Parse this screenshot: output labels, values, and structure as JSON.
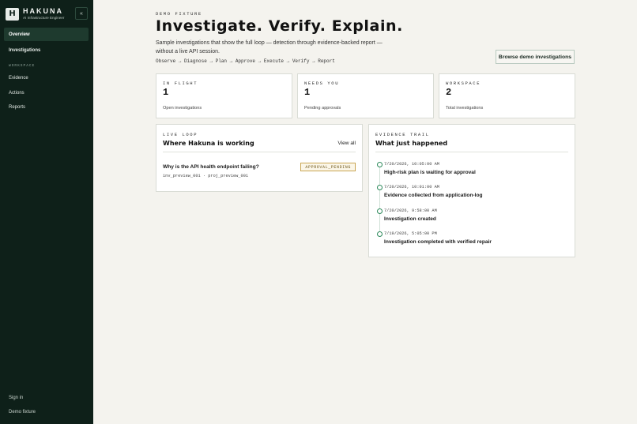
{
  "brand": {
    "logo_letter": "H",
    "name": "HAKUNA",
    "subtitle": "AI Infrastructure Engineer",
    "collapse_icon": "«"
  },
  "sidebar": {
    "items_top": [
      {
        "label": "Overview",
        "active": true
      },
      {
        "label": "Investigations",
        "active": false
      }
    ],
    "section_label": "WORKSPACE",
    "items_workspace": [
      {
        "label": "Evidence"
      },
      {
        "label": "Actions"
      },
      {
        "label": "Reports"
      }
    ],
    "footer": [
      {
        "label": "Sign in"
      },
      {
        "label": "Demo fixture"
      }
    ]
  },
  "hero": {
    "eyebrow": "DEMO FIXTURE",
    "title": "Investigate. Verify. Explain.",
    "description": "Sample investigations that show the full loop — detection through evidence-backed report — without a live API session.",
    "flow": "Observe → Diagnose → Plan → Approve → Execute → Verify → Report",
    "browse_button": "Browse demo investigations"
  },
  "stats": [
    {
      "eyebrow": "IN FLIGHT",
      "value": "1",
      "label": "Open investigations"
    },
    {
      "eyebrow": "NEEDS YOU",
      "value": "1",
      "label": "Pending approvals"
    },
    {
      "eyebrow": "WORKSPACE",
      "value": "2",
      "label": "Total investigations"
    }
  ],
  "live_loop": {
    "eyebrow": "LIVE LOOP",
    "title": "Where Hakuna is working",
    "view_all": "View all",
    "investigation": {
      "title": "Why is the API health endpoint failing?",
      "meta": "inv_preview_001 · proj_preview_001",
      "status": "APPROVAL_PENDING"
    }
  },
  "evidence_trail": {
    "eyebrow": "EVIDENCE TRAIL",
    "title": "What just happened",
    "events": [
      {
        "time": "7/20/2026, 10:05:00 AM",
        "text": "High-risk plan is waiting for approval"
      },
      {
        "time": "7/20/2026, 10:01:00 AM",
        "text": "Evidence collected from application-log"
      },
      {
        "time": "7/20/2026, 9:58:00 AM",
        "text": "Investigation created"
      },
      {
        "time": "7/19/2026, 5:05:00 PM",
        "text": "Investigation completed with verified repair"
      }
    ]
  },
  "colors": {
    "sidebar_bg": "#0e2019",
    "page_bg": "#f4f3ee",
    "accent_green": "#2e8a5c",
    "badge_border": "#c9a552"
  }
}
